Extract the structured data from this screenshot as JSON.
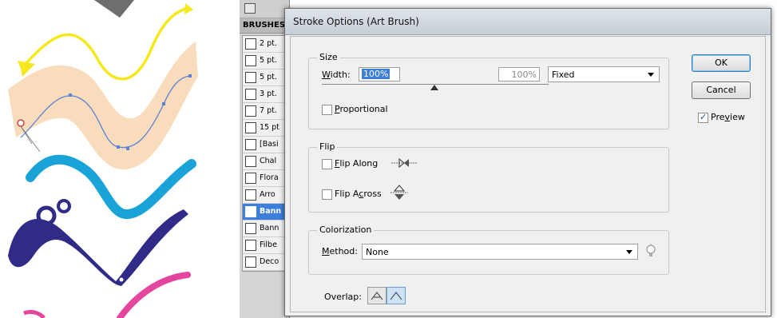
{
  "dialog": {
    "title": "Stroke Options (Art Brush)",
    "ok_label": "OK",
    "cancel_label": "Cancel",
    "preview_label_pre": "Pre",
    "preview_label_u": "v",
    "preview_label_post": "iew",
    "preview_checked": true
  },
  "size": {
    "title": "Size",
    "width_label_u": "W",
    "width_label_rest": "idth:",
    "width_value": "100%",
    "width_max_value": "100%",
    "mode_value": "Fixed",
    "proportional_label_u": "P",
    "proportional_label_rest": "roportional",
    "proportional_checked": false
  },
  "flip": {
    "title": "Flip",
    "flip_along_u": "F",
    "flip_along_rest": "lip Along",
    "flip_along_checked": false,
    "flip_across_pre": "Flip A",
    "flip_across_u": "c",
    "flip_across_post": "ross",
    "flip_across_checked": false
  },
  "colorization": {
    "title": "Colorization",
    "method_label_u": "M",
    "method_label_rest": "ethod:",
    "method_value": "None"
  },
  "overlap": {
    "label": "Overlap:"
  },
  "brushes_panel": {
    "tab_label": "BRUSHES",
    "items": [
      {
        "label": "2 pt."
      },
      {
        "label": "5 pt."
      },
      {
        "label": "5 pt."
      },
      {
        "label": "3 pt."
      },
      {
        "label": "7 pt."
      },
      {
        "label": "15 pt"
      },
      {
        "label": "[Basi"
      },
      {
        "label": "Chal"
      },
      {
        "label": "Flora"
      },
      {
        "label": "Arro"
      },
      {
        "label": "Bann"
      },
      {
        "label": "Bann"
      },
      {
        "label": "Filbe"
      },
      {
        "label": "Deco"
      }
    ],
    "selected_index": 10
  },
  "colors": {
    "yellow_stroke": "#f5e81e",
    "peach_band": "#f9dcbc",
    "path_blue": "#5a82d8",
    "cyan_brush": "#1aa3d6",
    "navy_brush": "#2f2b86",
    "pink_brush": "#e3469c",
    "selection_blue": "#3d7fdc"
  }
}
